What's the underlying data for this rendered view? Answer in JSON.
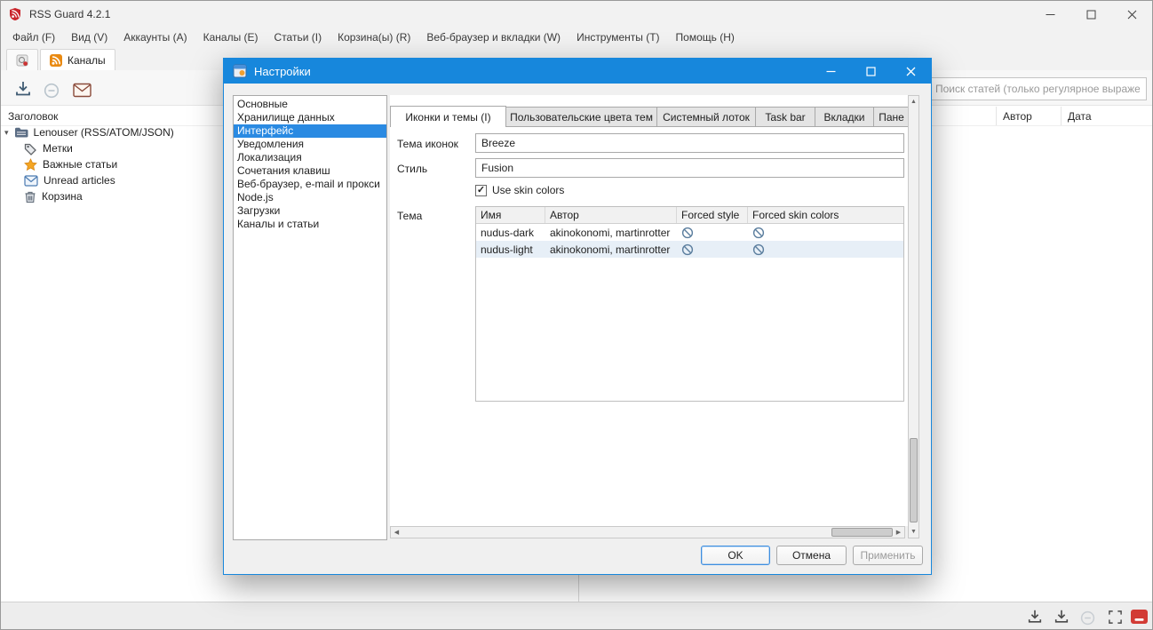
{
  "app": {
    "title": "RSS Guard 4.2.1",
    "menu": [
      "Файл (F)",
      "Вид (V)",
      "Аккаунты (A)",
      "Каналы (E)",
      "Статьи (I)",
      "Корзина(ы) (R)",
      "Веб-браузер и вкладки (W)",
      "Инструменты (T)",
      "Помощь (H)"
    ],
    "feeds_tab_label": "Каналы"
  },
  "feed_panel": {
    "header": "Заголовок",
    "items": [
      {
        "label": "Lenouser (RSS/ATOM/JSON)"
      },
      {
        "label": "Метки"
      },
      {
        "label": "Важные статьи"
      },
      {
        "label": "Unread articles"
      },
      {
        "label": "Корзина"
      }
    ]
  },
  "article_list": {
    "search_placeholder": "Поиск статей (только регулярное выражен...",
    "columns": [
      "Автор",
      "Дата"
    ]
  },
  "dialog": {
    "title": "Настройки",
    "categories": [
      "Основные",
      "Хранилище данных",
      "Интерфейс",
      "Уведомления",
      "Локализация",
      "Сочетания клавиш",
      "Веб-браузер, e-mail и прокси",
      "Node.js",
      "Загрузки",
      "Каналы и статьи"
    ],
    "selected_category": "Интерфейс",
    "tabs": [
      "Иконки и темы (I)",
      "Пользовательские цвета тем",
      "Системный лоток",
      "Task bar",
      "Вкладки",
      "Пане"
    ],
    "active_tab": "Иконки и темы (I)",
    "form": {
      "icon_theme_label": "Тема иконок",
      "icon_theme_value": "Breeze",
      "style_label": "Стиль",
      "style_value": "Fusion",
      "use_skin_colors_label": "Use skin colors",
      "use_skin_colors_checked": true,
      "theme_label": "Тема"
    },
    "theme_table": {
      "columns": [
        "Имя",
        "Автор",
        "Forced style",
        "Forced skin colors"
      ],
      "rows": [
        {
          "name": "nudus-dark",
          "author": "akinokonomi, martinrotter",
          "forced_style": "none",
          "forced_skin_colors": "none"
        },
        {
          "name": "nudus-light",
          "author": "akinokonomi, martinrotter",
          "forced_style": "none",
          "forced_skin_colors": "none"
        }
      ]
    },
    "buttons": {
      "ok": "OK",
      "cancel": "Отмена",
      "apply": "Применить"
    }
  },
  "colors": {
    "dialog_titlebar": "#1787dc",
    "selection_blue": "#2a8ae2",
    "app_icon_red": "#c9252b",
    "feed_icon_orange": "#e98a12",
    "row_highlight": "#e7eff7"
  },
  "icons": {
    "app-icon": "red rss shield",
    "feeds-tab-icon": "orange rss square",
    "download-icon": "arrow into tray",
    "mark-read-icon": "circle minus",
    "mail-icon": "envelope",
    "account-icon": "feed folder",
    "labels-icon": "tag",
    "important-icon": "star",
    "unread-icon": "envelope",
    "recycle-bin-icon": "trash can",
    "circle-slash-icon": "⊘ (not set)",
    "fullscreen-icon": "corner brackets",
    "hide-panel-icon": "red square with white bar"
  }
}
